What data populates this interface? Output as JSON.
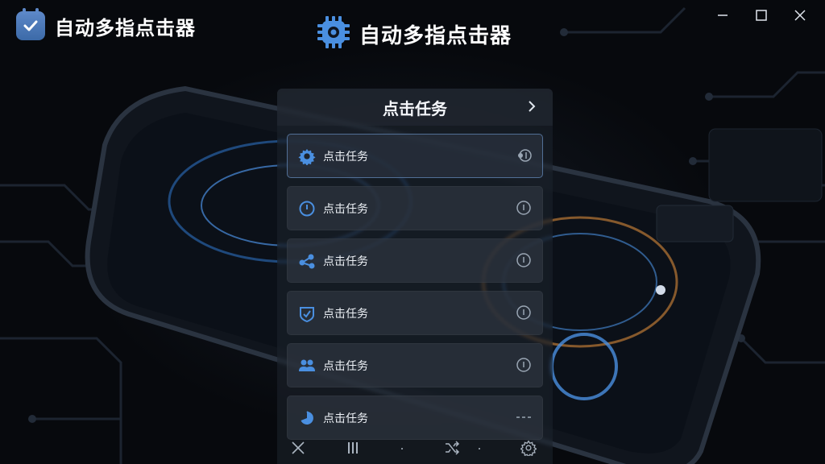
{
  "app": {
    "title": "自动多指点击器",
    "logo_icon": "calendar-check-icon"
  },
  "center_header": {
    "title": "自动多指点击器",
    "icon": "gear-chip-icon"
  },
  "window_controls": [
    "minimize-icon",
    "maximize-icon",
    "close-icon"
  ],
  "panel": {
    "title": "点击任务",
    "items": [
      {
        "label": "点击任务",
        "icon": "gear-icon",
        "action_icon": "touch-icon",
        "selected": true
      },
      {
        "label": "点击任务",
        "icon": "clock-icon",
        "action_icon": "info-icon",
        "selected": false
      },
      {
        "label": "点击任务",
        "icon": "share-icon",
        "action_icon": "info-icon",
        "selected": false
      },
      {
        "label": "点击任务",
        "icon": "shield-icon",
        "action_icon": "info-icon",
        "selected": false
      },
      {
        "label": "点击任务",
        "icon": "users-icon",
        "action_icon": "info-icon",
        "selected": false
      },
      {
        "label": "点击任务",
        "icon": "pie-icon",
        "action_icon": "dashes-icon",
        "selected": false
      }
    ]
  },
  "toolbar": [
    "close-icon",
    "pause-icon",
    "shuffle-icon",
    "settings-icon"
  ],
  "colors": {
    "accent": "#4a8fe0",
    "panel": "#1e242e",
    "text": "#eef2f7"
  }
}
